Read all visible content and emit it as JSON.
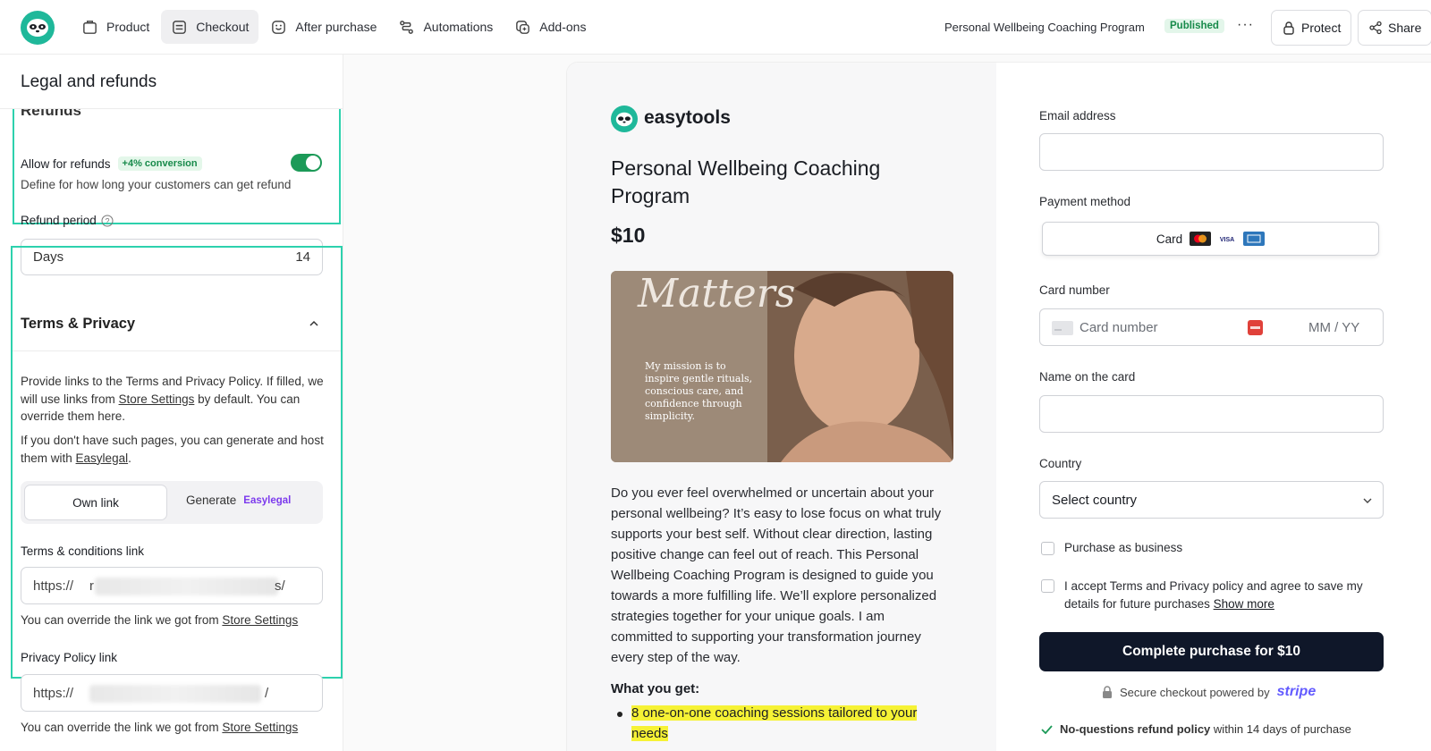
{
  "nav": {
    "items": [
      {
        "label": "Product",
        "icon": "box-icon",
        "active": false
      },
      {
        "label": "Checkout",
        "icon": "cart-icon",
        "active": true
      },
      {
        "label": "After purchase",
        "icon": "smile-icon",
        "active": false
      },
      {
        "label": "Automations",
        "icon": "flow-icon",
        "active": false
      },
      {
        "label": "Add-ons",
        "icon": "addon-icon",
        "active": false
      }
    ],
    "product_name": "Personal Wellbeing Coaching Program",
    "status": "Published",
    "more": "···",
    "protect": "Protect",
    "share": "Share"
  },
  "sidebar": {
    "title": "Legal and refunds",
    "cut_heading": "Refunds",
    "refunds": {
      "allow_label": "Allow for refunds",
      "conversion_badge": "+4% conversion",
      "toggle_on": true,
      "description": "Define for how long your customers can get refund",
      "period_label": "Refund period",
      "period_unit": "Days",
      "period_value": "14"
    },
    "terms": {
      "heading": "Terms & Privacy",
      "p1_before": "Provide links to the Terms and Privacy Policy. If filled, we will use links from",
      "p1_link": "Store Settings",
      "p1_after": "by default. You can override them here.",
      "p2_before": "If you don't have such pages, you can generate and host them with",
      "p2_link": "Easylegal",
      "p2_after": ".",
      "seg_own": "Own link",
      "seg_generate": "Generate",
      "seg_easylegal": "Easylegal",
      "tc_label": "Terms & conditions link",
      "tc_prefix": "https://",
      "tc_start": "r",
      "tc_end": "s/",
      "override_before": "You can override the link we got from",
      "override_link": "Store Settings",
      "pp_label": "Privacy Policy link",
      "pp_prefix": "https://",
      "pp_end": "/"
    }
  },
  "checkout": {
    "brand": "easytools",
    "product_title": "Personal Wellbeing Coaching Program",
    "price": "$10",
    "image_script_word": "Matters",
    "image_quote": "My mission is to inspire gentle rituals, conscious care, and confidence through simplicity.",
    "description": "Do you ever feel overwhelmed or uncertain about your personal wellbeing? It’s easy to lose focus on what truly supports your best self. Without clear direction, lasting positive change can feel out of reach. This Personal Wellbeing Coaching Program is designed to guide you towards a more fulfilling life. We’ll explore personalized strategies together for your unique goals. I am committed to supporting your transformation journey every step of the way.",
    "what_you_get": "What you get:",
    "bullet1": "8 one-on-one coaching sessions tailored to your needs"
  },
  "form": {
    "email_label": "Email address",
    "payment_label": "Payment method",
    "card_option": "Card",
    "card_brands": [
      "mastercard-icon",
      "visa-icon",
      "amex-icon"
    ],
    "card_number_label": "Card number",
    "card_number_placeholder": "Card number",
    "expiry_placeholder": "MM / YY",
    "name_label": "Name on the card",
    "country_label": "Country",
    "country_value": "Select country",
    "business_label": "Purchase as business",
    "accept_text": "I accept Terms and Privacy policy and agree to save my details for future purchases",
    "show_more": "Show more",
    "cta": "Complete purchase for $10",
    "secure_text": "Secure checkout powered by",
    "stripe": "stripe",
    "refund_bold": "No-questions refund policy",
    "refund_rest": "within 14 days of purchase"
  },
  "colors": {
    "accent": "#2dd1ad",
    "toggle": "#1c9a58",
    "cta": "#0f1729",
    "stripe": "#635bff",
    "easylegal": "#7c3aed",
    "highlight": "#f6f235"
  }
}
